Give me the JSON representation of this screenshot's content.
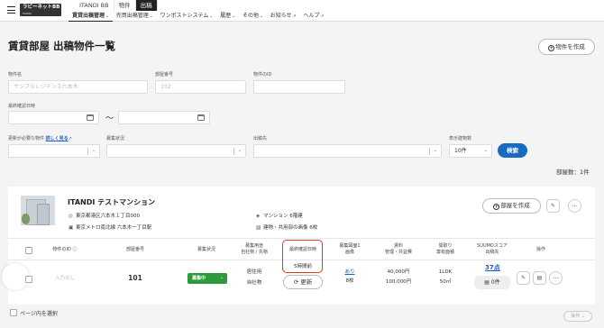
{
  "header": {
    "logo_text": "ラビーネットBB",
    "logo_sub": "ITANDI",
    "app_tabs": [
      "ITANDI BB",
      "物件",
      "出稿"
    ],
    "nav": [
      {
        "label": "賃貸出稿管理"
      },
      {
        "label": "売買出稿管理"
      },
      {
        "label": "ワンポストシステム"
      },
      {
        "label": "履歴"
      },
      {
        "label": "その他"
      },
      {
        "label": "お知らせ"
      },
      {
        "label": "ヘルプ"
      }
    ]
  },
  "page": {
    "title": "賃貸部屋 出稿物件一覧",
    "create_label": "物件を作成",
    "count_text": "部屋数：1件"
  },
  "filters": {
    "property_name": {
      "label": "物件名",
      "placeholder": "サンプルレジデンス六本木"
    },
    "room_number": {
      "label": "部屋番号",
      "placeholder": "102"
    },
    "property_id": {
      "label": "物件のID",
      "placeholder": ""
    },
    "last_confirmed": {
      "label": "最終確認日時",
      "tilde": "〜"
    },
    "update_needed": {
      "label": "更新が必要な物件",
      "link": "詳しく見る"
    },
    "recruit_status": {
      "label": "募集状況"
    },
    "destination": {
      "label": "出稿先"
    },
    "display_count": {
      "label": "表示建物数",
      "value": "10件"
    },
    "search_label": "検索"
  },
  "property": {
    "name": "ITANDI テストマンション",
    "address": "東京都港区六本木１丁目000",
    "station": "東京メトロ南北線 六本木一丁目駅",
    "structure": "マンション 6階建",
    "images": "建物・共用部の画像 6枚",
    "create_room_label": "部屋を作成"
  },
  "table": {
    "headers": {
      "property_id": "物件のID",
      "room_number": "部屋番号",
      "status": "募集状況",
      "usage_1": "募集用途",
      "usage_2": "自社物 / 先物",
      "confirmed": "最終確認日時",
      "plan_1": "募集図面1",
      "plan_2": "画像",
      "rent_1": "賃料",
      "rent_2": "管理・共益費",
      "layout_1": "間取り",
      "layout_2": "専有面積",
      "suumo_1": "SUUMOスコア",
      "suumo_2": "出稿先",
      "ops": "操作"
    },
    "row": {
      "property_id": "入力なし",
      "room_number": "101",
      "status": "募集中",
      "usage": "居住用",
      "ownership": "自社物",
      "confirmed": "5時間前",
      "update_label": "更新",
      "plan": "あり",
      "image_count": "8枚",
      "rent": "40,000円",
      "fee": "100,000円",
      "layout": "1LDK",
      "area": "50㎡",
      "suumo_score": "37点",
      "suumo_dest": "0件"
    }
  },
  "footer": {
    "select_page": "ページ内を選択",
    "ops_label": "操作"
  }
}
